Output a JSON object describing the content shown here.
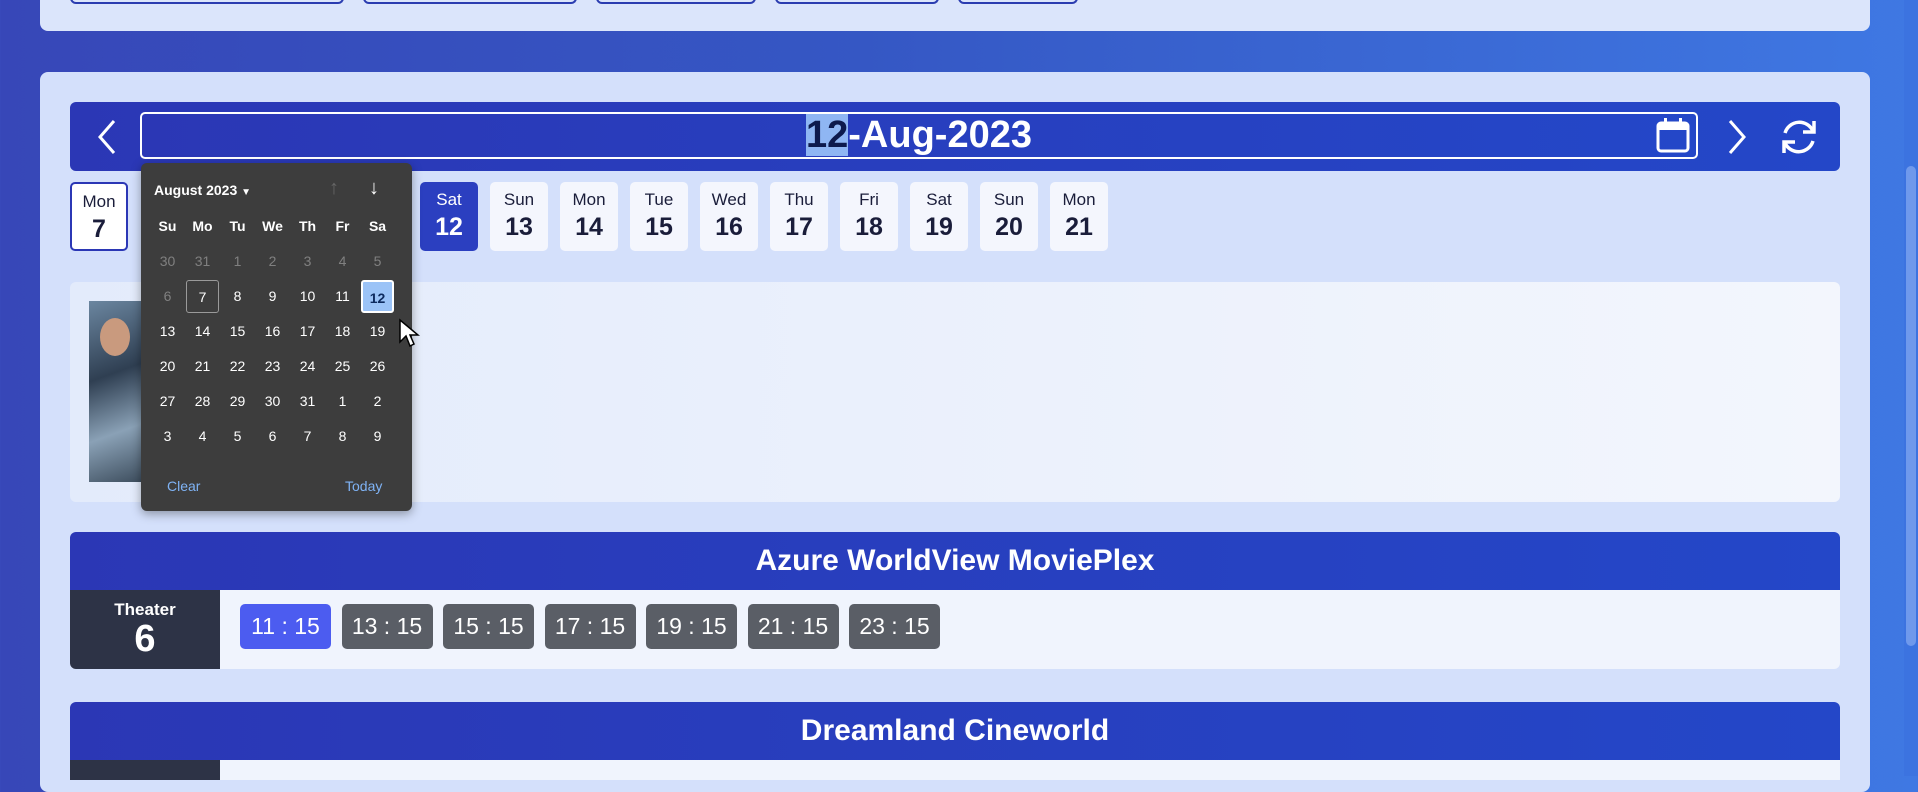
{
  "date_bar": {
    "date_day_selected": "12",
    "date_rest": "-Aug-2023",
    "prev_icon": "chevron-left-icon",
    "next_icon": "chevron-right-icon",
    "refresh_icon": "refresh-icon",
    "calendar_icon": "calendar-icon"
  },
  "day_strip": [
    {
      "name": "Mon",
      "num": "7"
    },
    {
      "name": "Sat",
      "num": "12"
    },
    {
      "name": "Sun",
      "num": "13"
    },
    {
      "name": "Mon",
      "num": "14"
    },
    {
      "name": "Tue",
      "num": "15"
    },
    {
      "name": "Wed",
      "num": "16"
    },
    {
      "name": "Thu",
      "num": "17"
    },
    {
      "name": "Fri",
      "num": "18"
    },
    {
      "name": "Sat",
      "num": "19"
    },
    {
      "name": "Sun",
      "num": "20"
    },
    {
      "name": "Mon",
      "num": "21"
    }
  ],
  "datepicker": {
    "month_label": "August 2023",
    "weekdays": [
      "Su",
      "Mo",
      "Tu",
      "We",
      "Th",
      "Fr",
      "Sa"
    ],
    "weeks": [
      [
        "30",
        "31",
        "1",
        "2",
        "3",
        "4",
        "5"
      ],
      [
        "6",
        "7",
        "8",
        "9",
        "10",
        "11",
        "12"
      ],
      [
        "13",
        "14",
        "15",
        "16",
        "17",
        "18",
        "19"
      ],
      [
        "20",
        "21",
        "22",
        "23",
        "24",
        "25",
        "26"
      ],
      [
        "27",
        "28",
        "29",
        "30",
        "31",
        "1",
        "2"
      ],
      [
        "3",
        "4",
        "5",
        "6",
        "7",
        "8",
        "9"
      ]
    ],
    "clear_label": "Clear",
    "today_label": "Today"
  },
  "theaters": [
    {
      "name": "Azure WorldView MoviePlex",
      "label": "Theater",
      "number": "6",
      "times": [
        "11 : 15",
        "13 : 15",
        "15 : 15",
        "17 : 15",
        "19 : 15",
        "21 : 15",
        "23 : 15"
      ]
    },
    {
      "name": "Dreamland Cineworld"
    }
  ],
  "colors": {
    "accent": "#2b37b5",
    "active_time": "#4c5cf0",
    "time_button": "#5a5e66",
    "picker_selected": "#9bc3f7"
  }
}
